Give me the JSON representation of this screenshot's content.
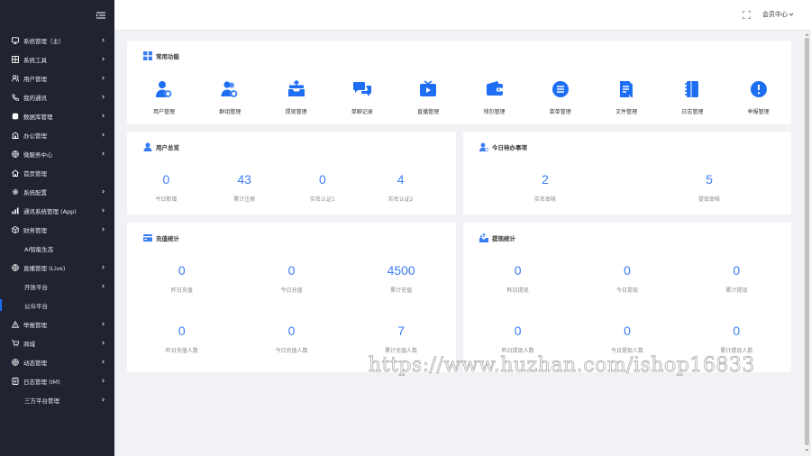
{
  "sidebar": {
    "items": [
      {
        "label": "系统管理（主）",
        "icon": "monitor-icon",
        "arrow": true
      },
      {
        "label": "系统工具",
        "icon": "grid-tool-icon",
        "arrow": true
      },
      {
        "label": "用户管理",
        "icon": "users-icon",
        "arrow": true
      },
      {
        "label": "我的通讯",
        "icon": "phone-icon",
        "arrow": true
      },
      {
        "label": "数据库管理",
        "icon": "database-icon",
        "arrow": true
      },
      {
        "label": "办公管理",
        "icon": "building-icon",
        "arrow": true
      },
      {
        "label": "微服务中心",
        "icon": "globe-icon",
        "arrow": true
      },
      {
        "label": "首页管理",
        "icon": "home-icon",
        "arrow": false
      },
      {
        "label": "系统配置",
        "icon": "gear-icon",
        "arrow": true
      },
      {
        "label": "通讯系统管理 (App)",
        "icon": "bar-chart-icon",
        "arrow": true
      },
      {
        "label": "财务管理",
        "icon": "cube-icon",
        "arrow": true
      },
      {
        "label": "AI智能生态",
        "icon": "",
        "arrow": false,
        "sub": true
      },
      {
        "label": "直播管理 (Live)",
        "icon": "globe-icon",
        "arrow": true
      },
      {
        "label": "开放平台",
        "icon": "",
        "arrow": true,
        "sub": true
      },
      {
        "label": "公众平台",
        "icon": "",
        "arrow": false,
        "sub": true,
        "active": true
      },
      {
        "label": "举报管理",
        "icon": "warning-icon",
        "arrow": true
      },
      {
        "label": "商城",
        "icon": "cart-icon",
        "arrow": true
      },
      {
        "label": "动态管理",
        "icon": "aperture-icon",
        "arrow": true
      },
      {
        "label": "日志管理 (IM)",
        "icon": "document-icon",
        "arrow": true
      },
      {
        "label": "三方平台管理",
        "icon": "",
        "arrow": true,
        "sub": true
      }
    ]
  },
  "header": {
    "member_center": "会员中心"
  },
  "functions": {
    "title": "常用功能",
    "items": [
      {
        "label": "用户管理",
        "icon": "user-gear-icon"
      },
      {
        "label": "群组管理",
        "icon": "group-gear-icon"
      },
      {
        "label": "提现管理",
        "icon": "withdraw-tray-icon"
      },
      {
        "label": "单聊记录",
        "icon": "chat-bubbles-icon"
      },
      {
        "label": "直播管理",
        "icon": "tv-play-icon"
      },
      {
        "label": "钱包管理",
        "icon": "wallet-icon"
      },
      {
        "label": "菜单管理",
        "icon": "menu-list-icon"
      },
      {
        "label": "文件管理",
        "icon": "file-icon"
      },
      {
        "label": "日志管理",
        "icon": "notebook-icon"
      },
      {
        "label": "举报管理",
        "icon": "alert-circle-icon"
      }
    ]
  },
  "user_summary": {
    "title": "用户总览",
    "stats": [
      {
        "value": "0",
        "label": "今日新增"
      },
      {
        "value": "43",
        "label": "累计注册"
      },
      {
        "value": "0",
        "label": "实名认证1"
      },
      {
        "value": "4",
        "label": "实名认证2"
      }
    ]
  },
  "todo": {
    "title": "今日待办事项",
    "stats": [
      {
        "value": "2",
        "label": "实名审核"
      },
      {
        "value": "5",
        "label": "提现审核"
      }
    ]
  },
  "recharge": {
    "title": "充值统计",
    "stats": [
      {
        "value": "0",
        "label": "昨日充值"
      },
      {
        "value": "0",
        "label": "今日充值"
      },
      {
        "value": "4500",
        "label": "累计充值"
      },
      {
        "value": "0",
        "label": "昨日充值人数"
      },
      {
        "value": "0",
        "label": "今日充值人数"
      },
      {
        "value": "7",
        "label": "累计充值人数"
      }
    ]
  },
  "withdraw": {
    "title": "提现统计",
    "stats": [
      {
        "value": "0",
        "label": "昨日提现"
      },
      {
        "value": "0",
        "label": "今日提现"
      },
      {
        "value": "0",
        "label": "累计提现"
      },
      {
        "value": "0",
        "label": "昨日提现人数"
      },
      {
        "value": "0",
        "label": "今日提现人数"
      },
      {
        "value": "0",
        "label": "累计提现人数"
      }
    ]
  },
  "colors": {
    "accent": "#3a7ef5",
    "sidebar_bg": "#1f2430"
  },
  "watermark": "https://www.huzhan.com/ishop16833"
}
